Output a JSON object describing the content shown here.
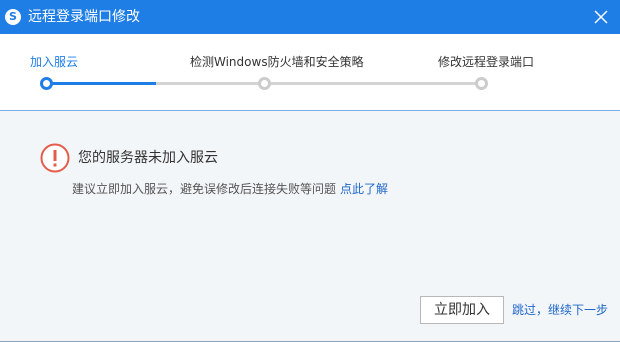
{
  "window": {
    "title": "远程登录端口修改",
    "logo_glyph": "S",
    "close_glyph": "×"
  },
  "steps": {
    "items": [
      {
        "label": "加入服云",
        "active": true
      },
      {
        "label": "检测Windows防火墙和安全策略",
        "active": false
      },
      {
        "label": "修改远程登录端口",
        "active": false
      }
    ]
  },
  "warning": {
    "icon": "exclamation-circle-icon",
    "title": "您的服务器未加入服云",
    "description": "建议立即加入服云，避免误修改后连接失败等问题",
    "link_text": "点此了解"
  },
  "actions": {
    "join_label": "立即加入",
    "skip_label": "跳过，继续下一步"
  },
  "colors": {
    "accent": "#1e7ee6",
    "warning": "#e35d4b",
    "link": "#1e66c8",
    "inactive_step": "#cccccc"
  }
}
